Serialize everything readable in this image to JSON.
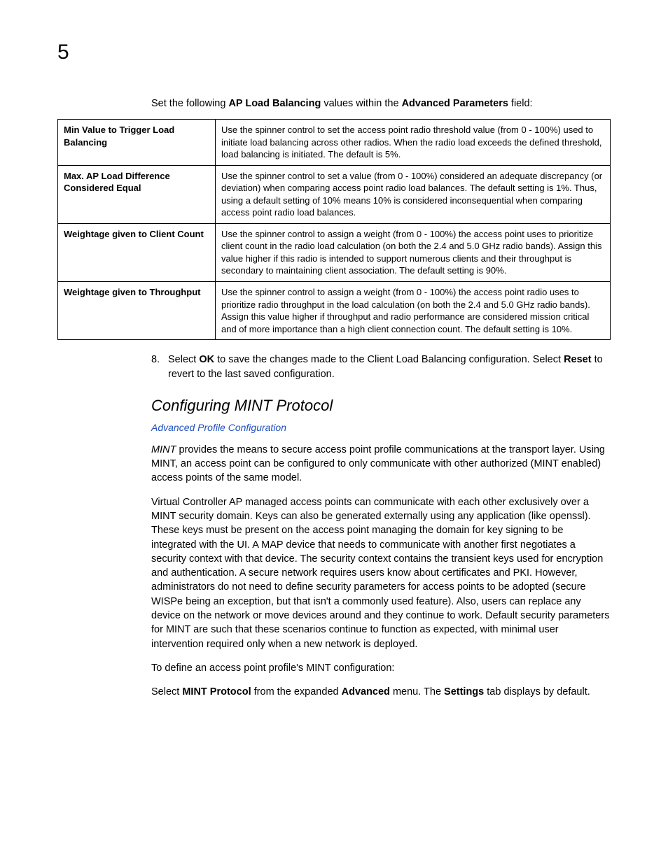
{
  "pageNumber": "5",
  "introPrefix": "Set the following ",
  "introBold1": "AP Load Balancing",
  "introMid": " values within the ",
  "introBold2": "Advanced Parameters",
  "introSuffix": " field:",
  "table": {
    "rows": [
      {
        "name": "Min Value to Trigger Load Balancing",
        "desc": "Use the spinner control to set the access point radio threshold value (from 0 - 100%) used to initiate load balancing across other radios. When the radio load exceeds the defined threshold, load balancing is initiated. The default is 5%."
      },
      {
        "name": "Max. AP Load Difference Considered Equal",
        "desc": "Use the spinner control to set a value (from 0 - 100%) considered an adequate discrepancy (or deviation) when comparing access point radio load balances. The default setting is 1%. Thus, using a default setting of 10% means 10% is considered inconsequential when comparing access point radio load balances."
      },
      {
        "name": "Weightage given to Client Count",
        "desc": "Use the spinner control to assign a weight (from 0 - 100%) the access point uses to prioritize client count in the radio load calculation (on both the 2.4 and 5.0 GHz radio bands). Assign this value higher if this radio is intended to support numerous clients and their throughput is secondary to maintaining client association. The default setting is 90%."
      },
      {
        "name": "Weightage given to Throughput",
        "desc": "Use the spinner control to assign a weight (from 0 - 100%) the access point radio uses to prioritize radio throughput in the load calculation (on both the 2.4 and 5.0 GHz radio bands). Assign this value higher if throughput and radio performance are considered mission critical and of more importance than a high client connection count. The default setting is 10%."
      }
    ]
  },
  "step8": {
    "num": "8.",
    "p1": "Select ",
    "b1": "OK",
    "p2": " to save the changes made to the Client Load Balancing configuration. Select ",
    "b2": "Reset",
    "p3": " to revert to the last saved configuration."
  },
  "sectionHead": "Configuring MINT Protocol",
  "linkLine": "Advanced Profile Configuration",
  "para1": {
    "it": "MINT",
    "rest": " provides the means to secure access point profile communications at the transport layer. Using MINT, an access point can be configured to only communicate with other authorized (MINT enabled) access points of the same model."
  },
  "para2": "Virtual Controller AP managed access points can communicate with each other exclusively over a MINT security domain. Keys can also be generated externally using any application (like openssl). These keys must be present on the access point managing the domain for key signing to be integrated with the UI. A MAP device that needs to communicate with another first negotiates a security context with that device. The security context contains the transient keys used for encryption and authentication. A secure network requires users know about certificates and PKI. However, administrators do not need to define security parameters for access points to be adopted (secure WISPe being an exception, but that isn't a commonly used feature). Also, users can replace any device on the network or move devices around and they continue to work. Default security parameters for MINT are such that these scenarios continue to function as expected, with minimal user intervention required only when a new network is deployed.",
  "para3": "To define an access point profile's MINT configuration:",
  "para4": {
    "p1": "Select ",
    "b1": "MINT Protocol",
    "p2": " from the expanded ",
    "b2": "Advanced",
    "p3": " menu. The ",
    "b3": "Settings",
    "p4": " tab displays by default."
  }
}
